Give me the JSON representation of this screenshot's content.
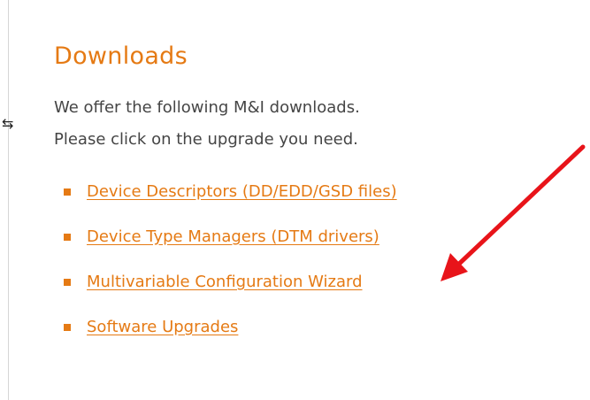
{
  "colors": {
    "heading": "#e57a14",
    "link": "#e57a14",
    "bullet": "#e57a14",
    "body_text": "#454545",
    "annotation_arrow": "#e8141a"
  },
  "heading": "Downloads",
  "intro": {
    "line1": "We offer the following M&I downloads.",
    "line2": "Please click on the upgrade you need."
  },
  "links": [
    {
      "label": "Device Descriptors (DD/EDD/GSD files)"
    },
    {
      "label": "Device Type Managers (DTM drivers)"
    },
    {
      "label": "Multivariable Configuration Wizard"
    },
    {
      "label": "Software Upgrades"
    }
  ],
  "annotation": {
    "icon": "arrow-icon",
    "points_to": "Device Type Managers (DTM drivers)"
  }
}
